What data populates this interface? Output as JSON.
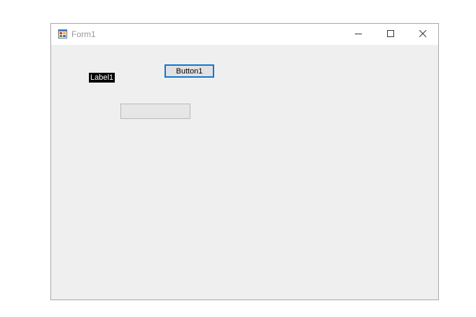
{
  "window": {
    "title": "Form1"
  },
  "titlebar": {
    "minimize_icon": "minimize-icon",
    "maximize_icon": "maximize-icon",
    "close_icon": "close-icon",
    "app_icon": "form-app-icon"
  },
  "form": {
    "label1_text": "Label1",
    "button1_label": "Button1",
    "textbox1_value": ""
  },
  "colors": {
    "client_background": "#efefef",
    "titlebar_background": "#ffffff",
    "button_focus_border": "#0a76d8",
    "label_background": "#000000",
    "label_text": "#ffffff"
  }
}
